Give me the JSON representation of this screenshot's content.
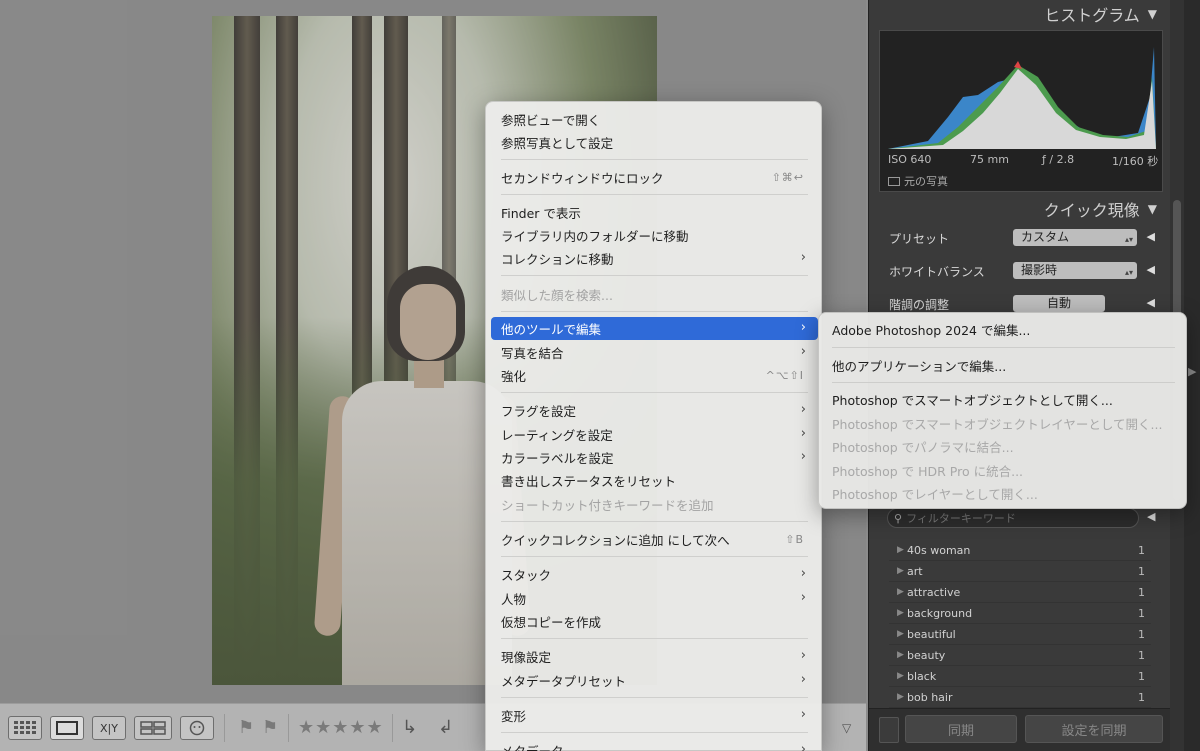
{
  "histogram": {
    "title": "ヒストグラム",
    "iso": "ISO 640",
    "focal": "75 mm",
    "aperture": "ƒ / 2.8",
    "shutter": "1/160 秒",
    "original_label": "元の写真"
  },
  "quick_develop": {
    "title": "クイック現像",
    "rows": [
      {
        "label": "プリセット",
        "value": "カスタム"
      },
      {
        "label": "ホワイトバランス",
        "value": "撮影時"
      },
      {
        "label": "階調の調整",
        "value": "自動"
      }
    ]
  },
  "keywords": {
    "placeholder": "フィルターキーワード",
    "items": [
      {
        "name": "40s woman",
        "count": "1"
      },
      {
        "name": "art",
        "count": "1"
      },
      {
        "name": "attractive",
        "count": "1"
      },
      {
        "name": "background",
        "count": "1"
      },
      {
        "name": "beautiful",
        "count": "1"
      },
      {
        "name": "beauty",
        "count": "1"
      },
      {
        "name": "black",
        "count": "1"
      },
      {
        "name": "bob hair",
        "count": "1"
      }
    ]
  },
  "sync": {
    "sync_label": "同期",
    "sync_settings_label": "設定を同期"
  },
  "toolbar": {
    "compare_label": "X|Y",
    "stars": "★★★★★"
  },
  "context_menu": {
    "items": [
      {
        "label": "参照ビューで開く"
      },
      {
        "label": "参照写真として設定"
      },
      {
        "label": "セカンドウィンドウにロック",
        "shortcut": "⇧⌘↩"
      },
      {
        "label": "Finder で表示"
      },
      {
        "label": "ライブラリ内のフォルダーに移動"
      },
      {
        "label": "コレクションに移動"
      },
      {
        "label": "類似した顔を検索..."
      },
      {
        "label": "他のツールで編集"
      },
      {
        "label": "写真を結合"
      },
      {
        "label": "強化",
        "shortcut": "^⌥⇧I"
      },
      {
        "label": "フラグを設定"
      },
      {
        "label": "レーティングを設定"
      },
      {
        "label": "カラーラベルを設定"
      },
      {
        "label": "書き出しステータスをリセット"
      },
      {
        "label": "ショートカット付きキーワードを追加"
      },
      {
        "label": "クイックコレクションに追加 にして次へ",
        "shortcut": "⇧B"
      },
      {
        "label": "スタック"
      },
      {
        "label": "人物"
      },
      {
        "label": "仮想コピーを作成"
      },
      {
        "label": "現像設定"
      },
      {
        "label": "メタデータプリセット"
      },
      {
        "label": "変形"
      },
      {
        "label": "メタデータ"
      }
    ]
  },
  "submenu": {
    "items": [
      {
        "label": "Adobe Photoshop 2024 で編集..."
      },
      {
        "label": "他のアプリケーションで編集..."
      },
      {
        "label": "Photoshop でスマートオブジェクトとして開く..."
      },
      {
        "label": "Photoshop でスマートオブジェクトレイヤーとして開く..."
      },
      {
        "label": "Photoshop でパノラマに結合..."
      },
      {
        "label": "Photoshop で HDR Pro に統合..."
      },
      {
        "label": "Photoshop でレイヤーとして開く..."
      }
    ]
  },
  "colors": {
    "highlight": "#2f6ad8",
    "panel": "#3a3a3a",
    "menu_bg": "#ececea"
  }
}
